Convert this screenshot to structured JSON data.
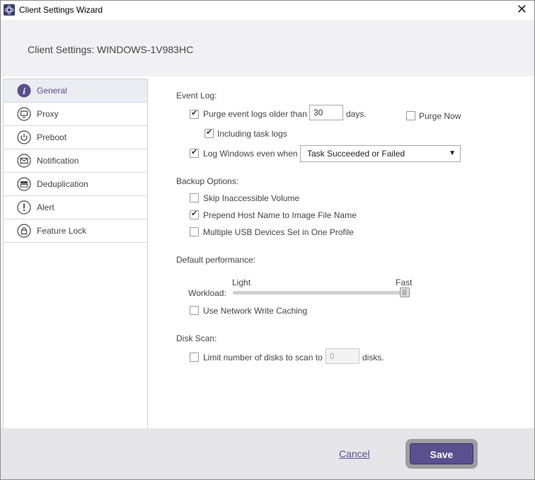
{
  "window": {
    "title": "Client Settings Wizard",
    "close_symbol": "✕"
  },
  "header": {
    "title": "Client Settings: WINDOWS-1V983HC"
  },
  "sidebar": {
    "items": [
      {
        "label": "General",
        "icon": "info-icon",
        "active": true
      },
      {
        "label": "Proxy",
        "icon": "monitor-icon"
      },
      {
        "label": "Preboot",
        "icon": "power-icon"
      },
      {
        "label": "Notification",
        "icon": "envelope-icon"
      },
      {
        "label": "Deduplication",
        "icon": "storage-icon"
      },
      {
        "label": "Alert",
        "icon": "exclamation-icon"
      },
      {
        "label": "Feature Lock",
        "icon": "lock-icon"
      }
    ]
  },
  "event_log": {
    "title": "Event Log:",
    "purge_label": "Purge event logs older than",
    "purge_checked": true,
    "purge_days_value": "30",
    "days_suffix": "days.",
    "purge_now_label": "Purge Now",
    "purge_now_checked": false,
    "include_task_label": "Including task logs",
    "include_task_checked": true,
    "log_windows_label": "Log Windows even when",
    "log_windows_checked": true,
    "log_windows_select": "Task Succeeded or Failed"
  },
  "backup_options": {
    "title": "Backup Options:",
    "skip_label": "Skip Inaccessible Volume",
    "skip_checked": false,
    "prepend_label": "Prepend Host Name to Image File Name",
    "prepend_checked": true,
    "multi_usb_label": "Multiple USB Devices Set in One Profile",
    "multi_usb_checked": false
  },
  "performance": {
    "title": "Default performance:",
    "workload_label": "Workload:",
    "min_label": "Light",
    "max_label": "Fast",
    "workload_level": 1.0,
    "network_cache_label": "Use Network Write Caching",
    "network_cache_checked": false
  },
  "disk_scan": {
    "title": "Disk Scan:",
    "limit_label": "Limit number of disks to scan to",
    "limit_checked": false,
    "limit_value": "0",
    "disks_suffix": "disks."
  },
  "footer": {
    "cancel_label": "Cancel",
    "save_label": "Save"
  },
  "colors": {
    "accent": "#5a4f8f",
    "header_bg": "#f1f1f5",
    "footer_bg": "#e6e6e9"
  }
}
